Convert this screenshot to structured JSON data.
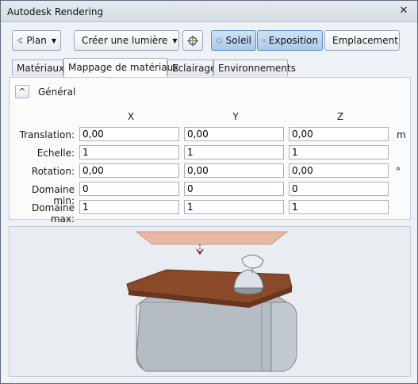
{
  "window": {
    "title": "Autodesk Rendering",
    "close_glyph": "✕"
  },
  "toolbar": {
    "plan_label": "Plan",
    "create_light_label": "Créer une lumière",
    "sun_label": "Soleil",
    "exposure_label": "Exposition",
    "location_label": "Emplacement"
  },
  "tabs": [
    {
      "label": "Matériaux",
      "active": false
    },
    {
      "label": "Mappage de matériaux",
      "active": true
    },
    {
      "label": "Eclairage",
      "active": false
    },
    {
      "label": "Environnements",
      "active": false
    }
  ],
  "section": {
    "title": "Général",
    "collapse_glyph": "^"
  },
  "columns": {
    "x": "X",
    "y": "Y",
    "z": "Z"
  },
  "rows": [
    {
      "label": "Translation:",
      "x": "0,00",
      "y": "0,00",
      "z": "0,00",
      "unit": "m"
    },
    {
      "label": "Echelle:",
      "x": "1",
      "y": "1",
      "z": "1",
      "unit": ""
    },
    {
      "label": "Rotation:",
      "x": "0,00",
      "y": "0,00",
      "z": "0,00",
      "unit": "°"
    },
    {
      "label": "Domaine min:",
      "x": "0",
      "y": "0",
      "z": "0",
      "unit": ""
    },
    {
      "label": "Domaine max:",
      "x": "1",
      "y": "1",
      "z": "1",
      "unit": ""
    }
  ],
  "colors": {
    "wood": "#8a4a2a",
    "body_gray": "#b9c0c8",
    "active_button": "#a9c9ea"
  }
}
